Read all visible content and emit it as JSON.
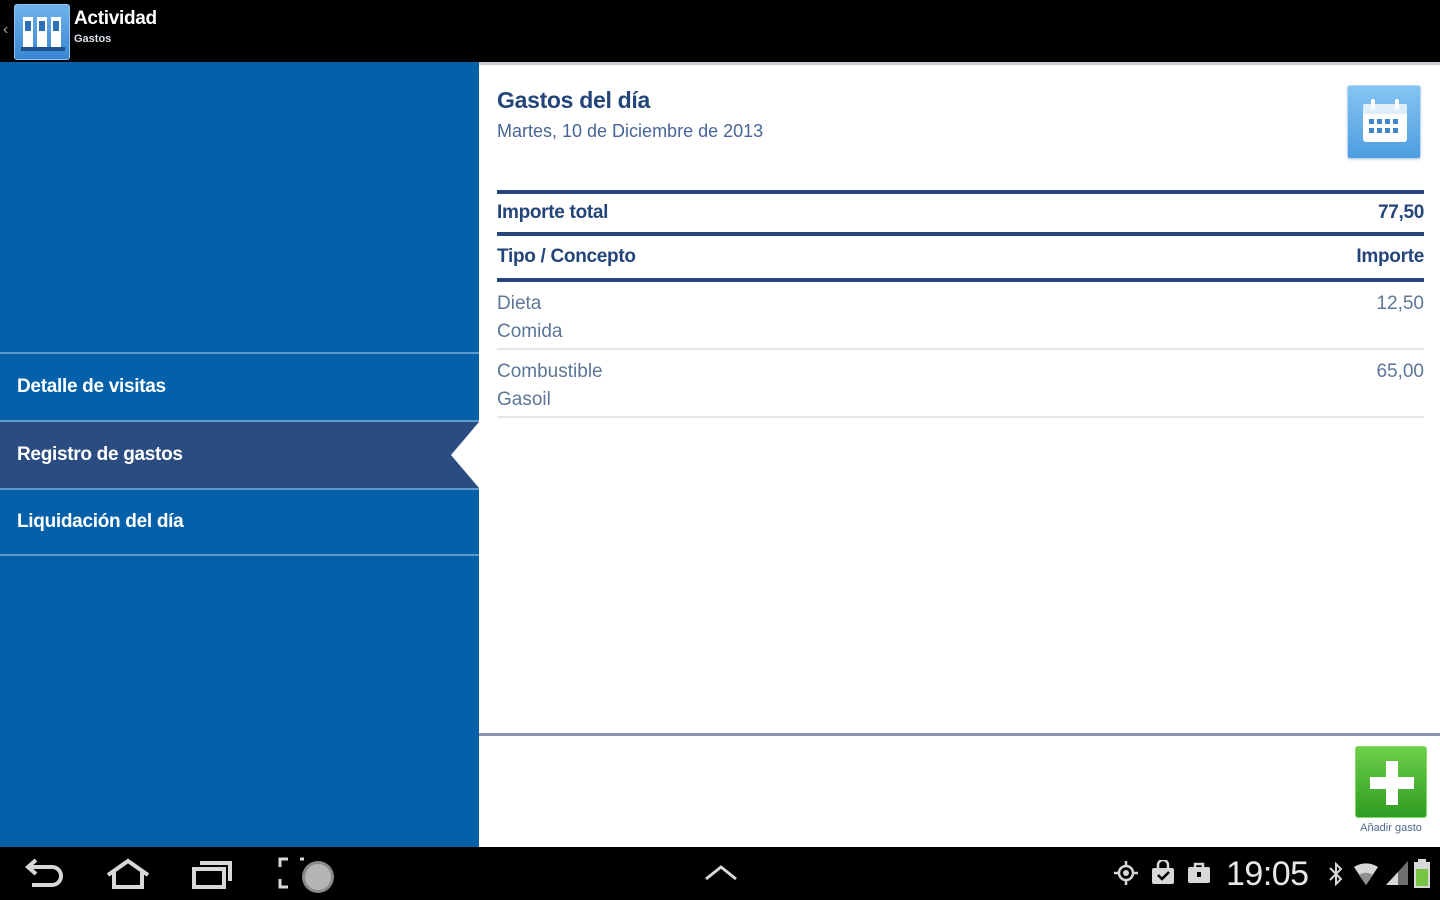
{
  "action_bar": {
    "title": "Actividad",
    "subtitle": "Gastos",
    "icons": {
      "up": "chevron-left-icon",
      "app": "app-logo-icon"
    }
  },
  "menu": {
    "items": [
      {
        "label": "Detalle de visitas",
        "selected": false
      },
      {
        "label": "Registro de gastos",
        "selected": true
      },
      {
        "label": "Liquidación del día",
        "selected": false
      }
    ]
  },
  "content": {
    "title": "Gastos del día",
    "date": "Martes, 10 de Diciembre de 2013",
    "calendar_icon": "calendar-icon",
    "total_label": "Importe total",
    "total_value": "77,50",
    "columns": {
      "concept": "Tipo / Concepto",
      "amount": "Importe"
    },
    "rows": [
      {
        "type": "Dieta",
        "concept": "Comida",
        "amount": "12,50"
      },
      {
        "type": "Combustible",
        "concept": "Gasoil",
        "amount": "65,00"
      }
    ],
    "add_button": {
      "icon": "plus-icon",
      "label": "Añadir gasto"
    }
  },
  "system_bar": {
    "time": "19:05",
    "nav_icons": [
      "back-icon",
      "home-icon",
      "recent-apps-icon",
      "screenshot-icon",
      "chevron-up-icon"
    ],
    "status_icons": [
      "gps-icon",
      "shopping-bag-icon",
      "briefcase-icon",
      "bluetooth-icon",
      "wifi-icon",
      "signal-icon",
      "battery-icon"
    ]
  },
  "colors": {
    "menu_bg": "#0460a9",
    "menu_selected": "#2b4c80",
    "title_text": "#24457a",
    "accent_green": "#2f9b22"
  }
}
